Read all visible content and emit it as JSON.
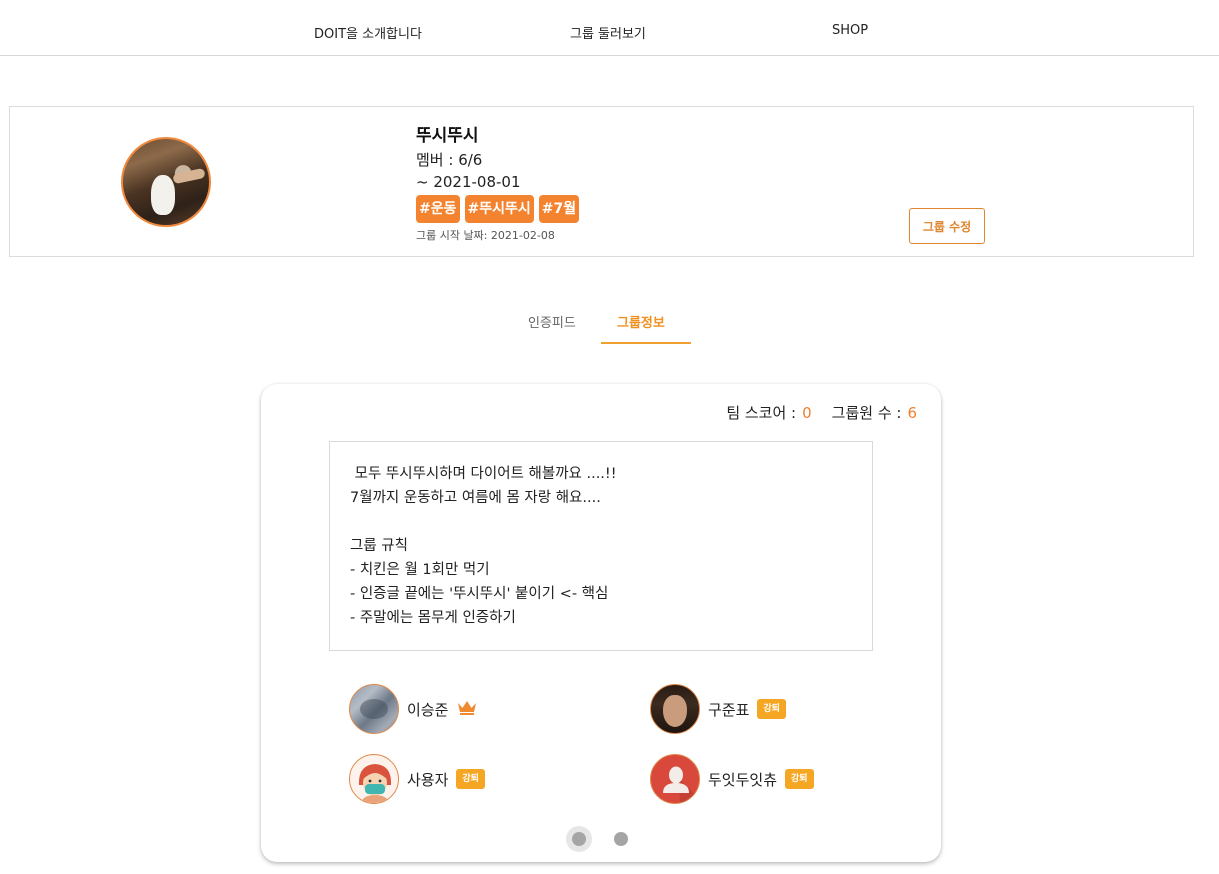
{
  "nav": {
    "items": [
      "DOIT을 소개합니다",
      "그룹 둘러보기",
      "SHOP"
    ]
  },
  "group": {
    "title": "뚜시뚜시",
    "members": "멤버 : 6/6",
    "end_date": "~ 2021-08-01",
    "tags": [
      "#운동",
      "#뚜시뚜시",
      "#7월"
    ],
    "start_date": "그룹 시작 날짜: 2021-02-08",
    "edit_label": "그룹 수정"
  },
  "tabs": {
    "feed": "인증피드",
    "info": "그룹정보",
    "active": "info"
  },
  "info": {
    "team_score_label": "팀 스코어 :",
    "team_score": "0",
    "member_count_label": "그룹원 수 :",
    "member_count": "6",
    "description_lines": [
      " 모두 뚜시뚜시하며 다이어트 해볼까요 ....!!",
      "7월까지 운동하고 여름에 몸 자랑 해요....",
      "",
      "그룹 규칙",
      "- 치킨은 월 1회만 먹기",
      "- 인증글 끝에는 '뚜시뚜시' 붙이기 <- 핵심",
      "- 주말에는 몸무게 인증하기"
    ]
  },
  "members": [
    {
      "name": "이승준",
      "role": "leader",
      "badge": ""
    },
    {
      "name": "구준표",
      "role": "member",
      "badge": "강퇴"
    },
    {
      "name": "사용자",
      "role": "member",
      "badge": "강퇴"
    },
    {
      "name": "두잇두잇츄",
      "role": "member",
      "badge": "강퇴"
    }
  ],
  "pagination": {
    "pages": 2,
    "current": 1
  },
  "colors": {
    "accent": "#f4832f",
    "tab_active": "#f0901f",
    "badge": "#f5a623"
  }
}
